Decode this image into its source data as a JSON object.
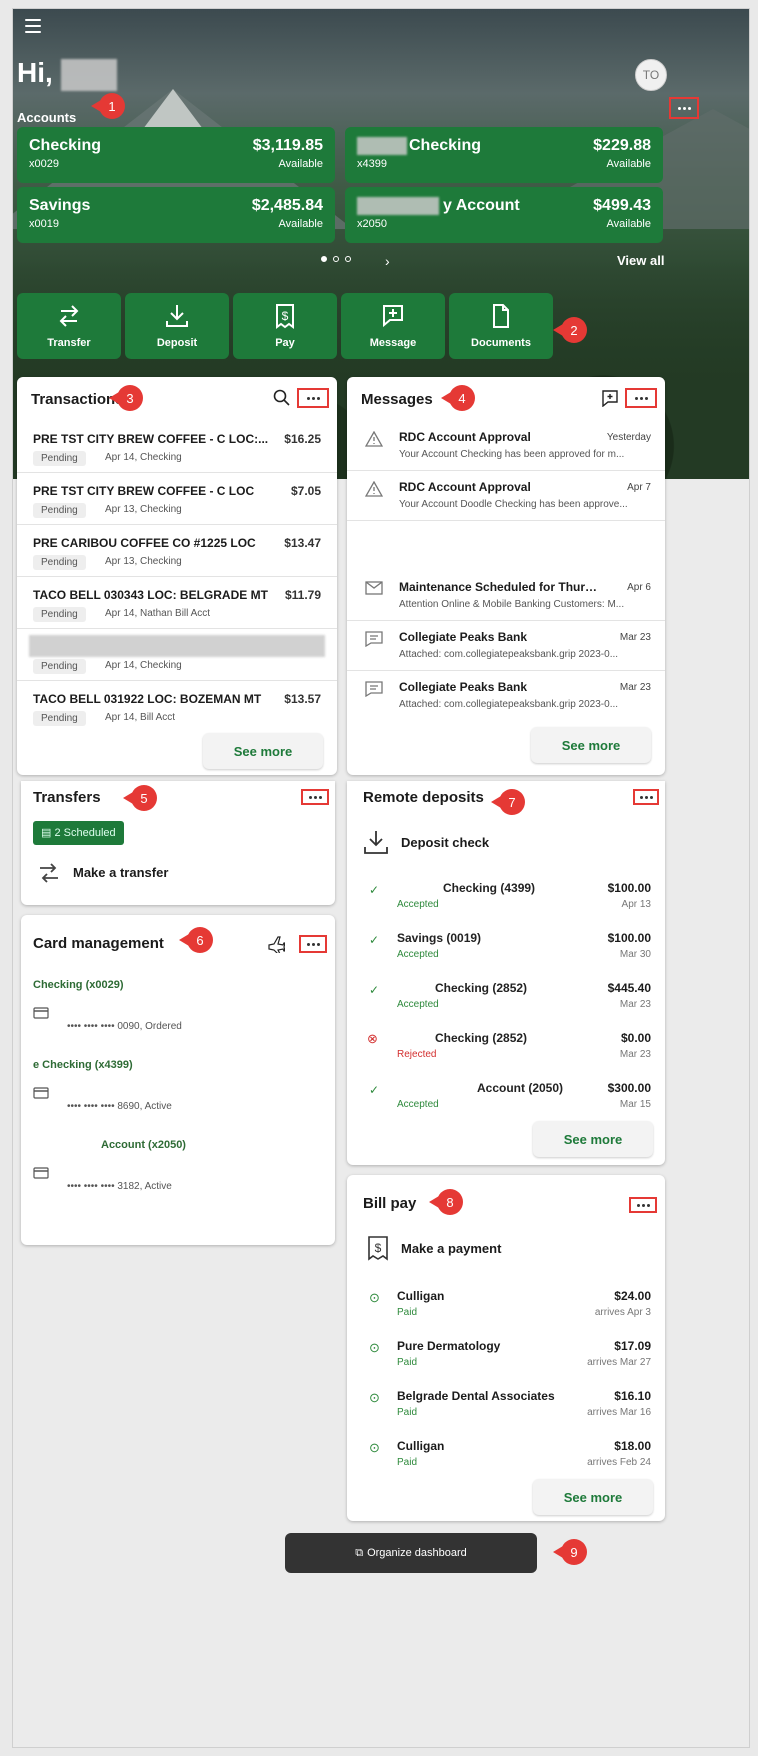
{
  "greeting": "Hi,",
  "avatar_initials": "TO",
  "accounts_label": "Accounts",
  "accounts": [
    {
      "name": "Checking",
      "number": "x0029",
      "amount": "$3,119.85",
      "available": "Available"
    },
    {
      "name": "Checking",
      "number": "x4399",
      "amount": "$229.88",
      "available": "Available"
    },
    {
      "name": "Savings",
      "number": "x0019",
      "amount": "$2,485.84",
      "available": "Available"
    },
    {
      "name": "y Account",
      "number": "x2050",
      "amount": "$499.43",
      "available": "Available"
    }
  ],
  "view_all": "View all",
  "actions": [
    "Transfer",
    "Deposit",
    "Pay",
    "Message",
    "Documents"
  ],
  "transactions": {
    "title": "Transactions",
    "items": [
      {
        "desc": "PRE TST CITY BREW COFFEE - C LOC:...",
        "amount": "$16.25",
        "status": "Pending",
        "sub": "Apr 14, Checking"
      },
      {
        "desc": "PRE TST CITY BREW COFFEE - C LOC",
        "amount": "$7.05",
        "status": "Pending",
        "sub": "Apr 13, Checking"
      },
      {
        "desc": "PRE CARIBOU COFFEE CO #1225 LOC",
        "amount": "$13.47",
        "status": "Pending",
        "sub": "Apr 13, Checking"
      },
      {
        "desc": "TACO BELL 030343 LOC: BELGRADE MT",
        "amount": "$11.79",
        "status": "Pending",
        "sub": "Apr 14, Nathan Bill Acct"
      },
      {
        "desc": "",
        "amount": "",
        "status": "Pending",
        "sub": "Apr 14, Checking"
      },
      {
        "desc": "TACO BELL 031922 LOC: BOZEMAN MT",
        "amount": "$13.57",
        "status": "Pending",
        "sub": "Apr 14,        Bill Acct"
      }
    ],
    "see_more": "See more"
  },
  "messages": {
    "title": "Messages",
    "items": [
      {
        "title": "RDC Account Approval",
        "date": "Yesterday",
        "snippet": "Your Account Checking has been approved for m...",
        "icon": "warning-icon"
      },
      {
        "title": "RDC Account Approval",
        "date": "Apr 7",
        "snippet": "Your Account Doodle Checking has been approve...",
        "icon": "warning-icon"
      },
      {
        "title": "Maintenance Scheduled for Thursda...",
        "date": "Apr 6",
        "snippet": "Attention Online & Mobile Banking Customers: M...",
        "icon": "mail-icon"
      },
      {
        "title": "Collegiate Peaks Bank",
        "date": "Mar 23",
        "snippet": "Attached: com.collegiatepeaksbank.grip 2023-0...",
        "icon": "chat-icon"
      },
      {
        "title": "Collegiate Peaks Bank",
        "date": "Mar 23",
        "snippet": "Attached: com.collegiatepeaksbank.grip 2023-0...",
        "icon": "chat-icon"
      }
    ],
    "see_more": "See more"
  },
  "transfers": {
    "title": "Transfers",
    "scheduled": "2 Scheduled",
    "make": "Make a transfer"
  },
  "remote_deposits": {
    "title": "Remote deposits",
    "deposit_check": "Deposit check",
    "items": [
      {
        "name": "Checking (4399)",
        "status": "Accepted",
        "amount": "$100.00",
        "date": "Apr 13"
      },
      {
        "name": "Savings         (0019)",
        "status": "Accepted",
        "amount": "$100.00",
        "date": "Mar 30"
      },
      {
        "name": "Checking     (2852)",
        "status": "Accepted",
        "amount": "$445.40",
        "date": "Mar 23"
      },
      {
        "name": "Checking     (2852)",
        "status": "Rejected",
        "amount": "$0.00",
        "date": "Mar 23"
      },
      {
        "name": "Account  (2050)",
        "status": "Accepted",
        "amount": "$300.00",
        "date": "Mar 15"
      }
    ],
    "see_more": "See more"
  },
  "card_management": {
    "title": "Card management",
    "groups": [
      {
        "account": "Checking (x0029)",
        "card": "•••• •••• •••• 0090, Ordered"
      },
      {
        "account": "e Checking (x4399)",
        "card": "•••• •••• •••• 8690, Active"
      },
      {
        "account": "Account (x2050)",
        "card": "•••• •••• •••• 3182, Active"
      }
    ]
  },
  "bill_pay": {
    "title": "Bill pay",
    "make": "Make a payment",
    "items": [
      {
        "name": "Culligan",
        "status": "Paid",
        "amount": "$24.00",
        "date": "arrives Apr 3"
      },
      {
        "name": "Pure Dermatology",
        "status": "Paid",
        "amount": "$17.09",
        "date": "arrives Mar 27"
      },
      {
        "name": "Belgrade Dental Associates",
        "status": "Paid",
        "amount": "$16.10",
        "date": "arrives Mar 16"
      },
      {
        "name": "Culligan",
        "status": "Paid",
        "amount": "$18.00",
        "date": "arrives Feb 24"
      }
    ],
    "see_more": "See more"
  },
  "organize": "Organize dashboard",
  "callouts": [
    "1",
    "2",
    "3",
    "4",
    "5",
    "6",
    "7",
    "8",
    "9"
  ],
  "colors": {
    "brand_green": "#1e7a3a",
    "highlight_red": "#e53935"
  }
}
